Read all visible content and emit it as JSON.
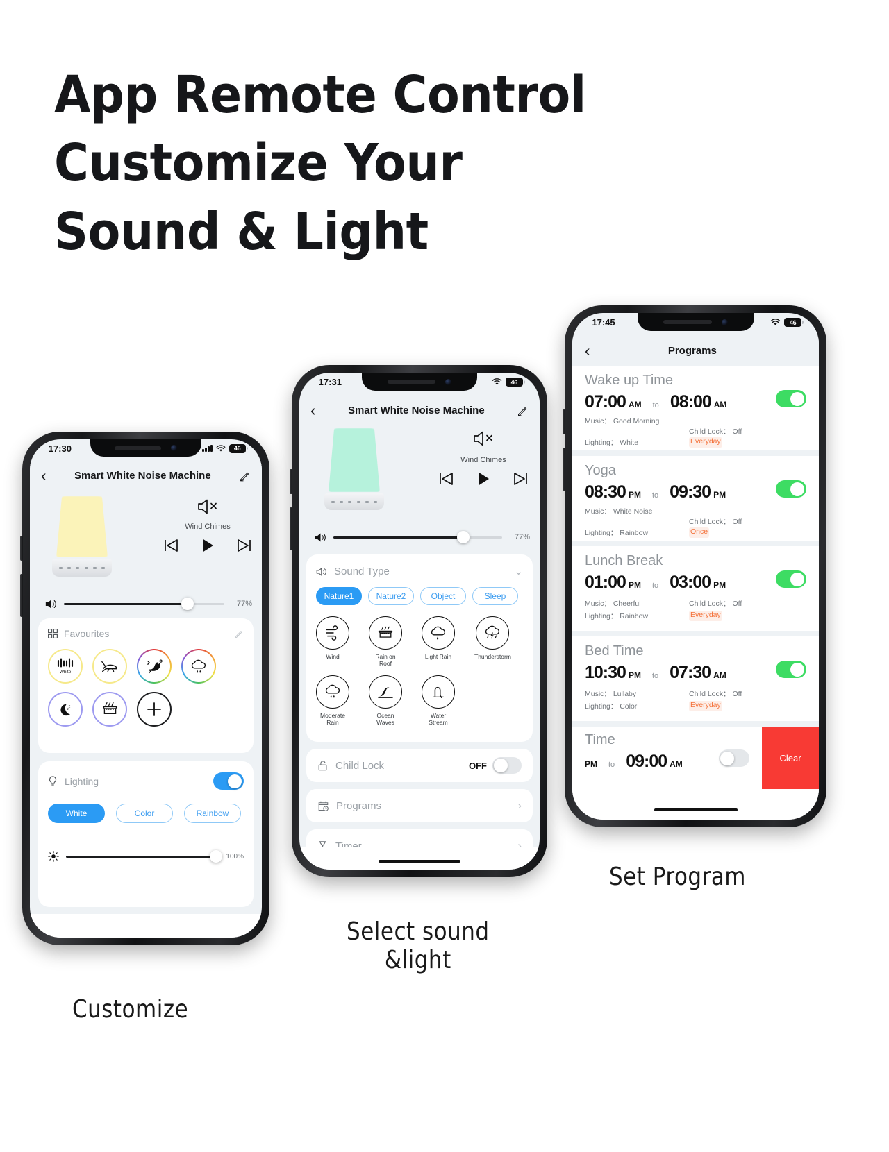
{
  "headline": {
    "line1": "App Remote Control",
    "line2": "Customize Your",
    "line3": "Sound & Light"
  },
  "captions": {
    "customize": "Customize",
    "select_sound_l1": "Select sound",
    "select_sound_l2": "&light",
    "set_program": "Set Program"
  },
  "colors": {
    "accent_blue": "#2b9bf4",
    "toggle_green": "#3ddc63",
    "clear_red": "#f83a34",
    "repeat_orange": "#f4723b",
    "lamp_yellow": "#fbf3b9",
    "lamp_mint": "#b6f2dc"
  },
  "phone1": {
    "status": {
      "time": "17:30",
      "battery": "46",
      "wifi_icon": "wifi-icon",
      "signal_icon": "signal-icon"
    },
    "nav": {
      "back_icon": "chevron-left-icon",
      "title": "Smart White Noise Machine",
      "edit_icon": "pencil-icon"
    },
    "player": {
      "mute_icon": "speaker-mute-icon",
      "track_name": "Wind Chimes",
      "prev_icon": "skip-previous-icon",
      "play_icon": "play-icon",
      "next_icon": "skip-next-icon"
    },
    "volume": {
      "icon": "volume-icon",
      "value": "77%",
      "percent": 77
    },
    "favourites": {
      "grid_icon": "grid-icon",
      "title": "Favourites",
      "edit_icon": "pencil-icon",
      "items": [
        {
          "label": "White",
          "icon": "white-noise-icon",
          "ring": "yellow"
        },
        {
          "label": "",
          "icon": "cricket-icon",
          "ring": "yellow"
        },
        {
          "label": "",
          "icon": "bird-icon",
          "ring": "rainbow"
        },
        {
          "label": "",
          "icon": "rain-cloud-icon",
          "ring": "rainbow"
        },
        {
          "label": "",
          "icon": "moon-sleep-icon",
          "ring": "purple"
        },
        {
          "label": "",
          "icon": "rain-on-roof-icon",
          "ring": "purple"
        },
        {
          "label": "",
          "icon": "plus-icon",
          "ring": "black"
        }
      ]
    },
    "lighting": {
      "icon": "bulb-icon",
      "title": "Lighting",
      "toggle_on": true,
      "modes": [
        {
          "label": "White",
          "selected": true
        },
        {
          "label": "Color",
          "selected": false
        },
        {
          "label": "Rainbow",
          "selected": false
        }
      ]
    },
    "brightness": {
      "icon": "brightness-icon",
      "value": "100%",
      "percent": 100
    }
  },
  "phone2": {
    "status": {
      "time": "17:31",
      "battery": "46",
      "wifi_icon": "wifi-icon"
    },
    "nav": {
      "back_icon": "chevron-left-icon",
      "title": "Smart White Noise Machine",
      "edit_icon": "pencil-icon"
    },
    "player": {
      "mute_icon": "speaker-mute-icon",
      "track_name": "Wind Chimes",
      "prev_icon": "skip-previous-icon",
      "play_icon": "play-icon",
      "next_icon": "skip-next-icon"
    },
    "volume": {
      "icon": "volume-icon",
      "value": "77%",
      "percent": 77
    },
    "sound_type": {
      "icon": "speaker-icon",
      "title": "Sound Type",
      "collapse_icon": "chevron-down-icon",
      "tabs": [
        {
          "label": "Nature1",
          "selected": true
        },
        {
          "label": "Nature2",
          "selected": false
        },
        {
          "label": "Object",
          "selected": false
        },
        {
          "label": "Sleep",
          "selected": false
        }
      ],
      "sounds": [
        {
          "label": "Wind",
          "icon": "wind-icon"
        },
        {
          "label": "Rain on Roof",
          "icon": "rain-on-roof-icon"
        },
        {
          "label": "Light Rain",
          "icon": "light-rain-icon"
        },
        {
          "label": "Thunderstorm",
          "icon": "thunderstorm-icon"
        },
        {
          "label": "Moderate Rain",
          "icon": "moderate-rain-icon"
        },
        {
          "label": "Ocean Waves",
          "icon": "ocean-waves-icon"
        },
        {
          "label": "Water Stream",
          "icon": "water-stream-icon"
        }
      ]
    },
    "child_lock": {
      "icon": "lock-icon",
      "label": "Child Lock",
      "state": "OFF",
      "toggle_on": false
    },
    "programs_row": {
      "icon": "calendar-clock-icon",
      "label": "Programs",
      "chevron": "chevron-right-icon"
    },
    "timer_row": {
      "icon": "hourglass-icon",
      "label": "Timer",
      "chevron": "chevron-right-icon"
    }
  },
  "phone3": {
    "status": {
      "time": "17:45",
      "battery": "46",
      "wifi_icon": "wifi-icon"
    },
    "nav": {
      "back_icon": "chevron-left-icon",
      "title": "Programs"
    },
    "programs": [
      {
        "name": "Wake up Time",
        "start_time": "07:00",
        "start_ampm": "AM",
        "to": "to",
        "end_time": "08:00",
        "end_ampm": "AM",
        "music_label": "Music：",
        "music_value": "Good Morning",
        "child_lock_label": "Child Lock：",
        "child_lock_value": "Off",
        "lighting_label": "Lighting：",
        "lighting_value": "White",
        "repeat": "Everyday",
        "enabled": true
      },
      {
        "name": "Yoga",
        "start_time": "08:30",
        "start_ampm": "PM",
        "to": "to",
        "end_time": "09:30",
        "end_ampm": "PM",
        "music_label": "Music：",
        "music_value": "White Noise",
        "child_lock_label": "Child Lock：",
        "child_lock_value": "Off",
        "lighting_label": "Lighting：",
        "lighting_value": "Rainbow",
        "repeat": "Once",
        "enabled": true
      },
      {
        "name": "Lunch Break",
        "start_time": "01:00",
        "start_ampm": "PM",
        "to": "to",
        "end_time": "03:00",
        "end_ampm": "PM",
        "music_label": "Music：",
        "music_value": "Cheerful",
        "child_lock_label": "Child Lock：",
        "child_lock_value": "Off",
        "lighting_label": "Lighting：",
        "lighting_value": "Rainbow",
        "repeat": "Everyday",
        "enabled": true
      },
      {
        "name": "Bed Time",
        "start_time": "10:30",
        "start_ampm": "PM",
        "to": "to",
        "end_time": "07:30",
        "end_ampm": "AM",
        "music_label": "Music：",
        "music_value": "Lullaby",
        "child_lock_label": "Child Lock：",
        "child_lock_value": "Off",
        "lighting_label": "Lighting：",
        "lighting_value": "Color",
        "repeat": "Everyday",
        "enabled": true
      }
    ],
    "partial": {
      "name": "Time",
      "start_ampm": "PM",
      "to": "to",
      "end_time": "09:00",
      "end_ampm": "AM",
      "enabled": false,
      "clear_label": "Clear"
    }
  }
}
